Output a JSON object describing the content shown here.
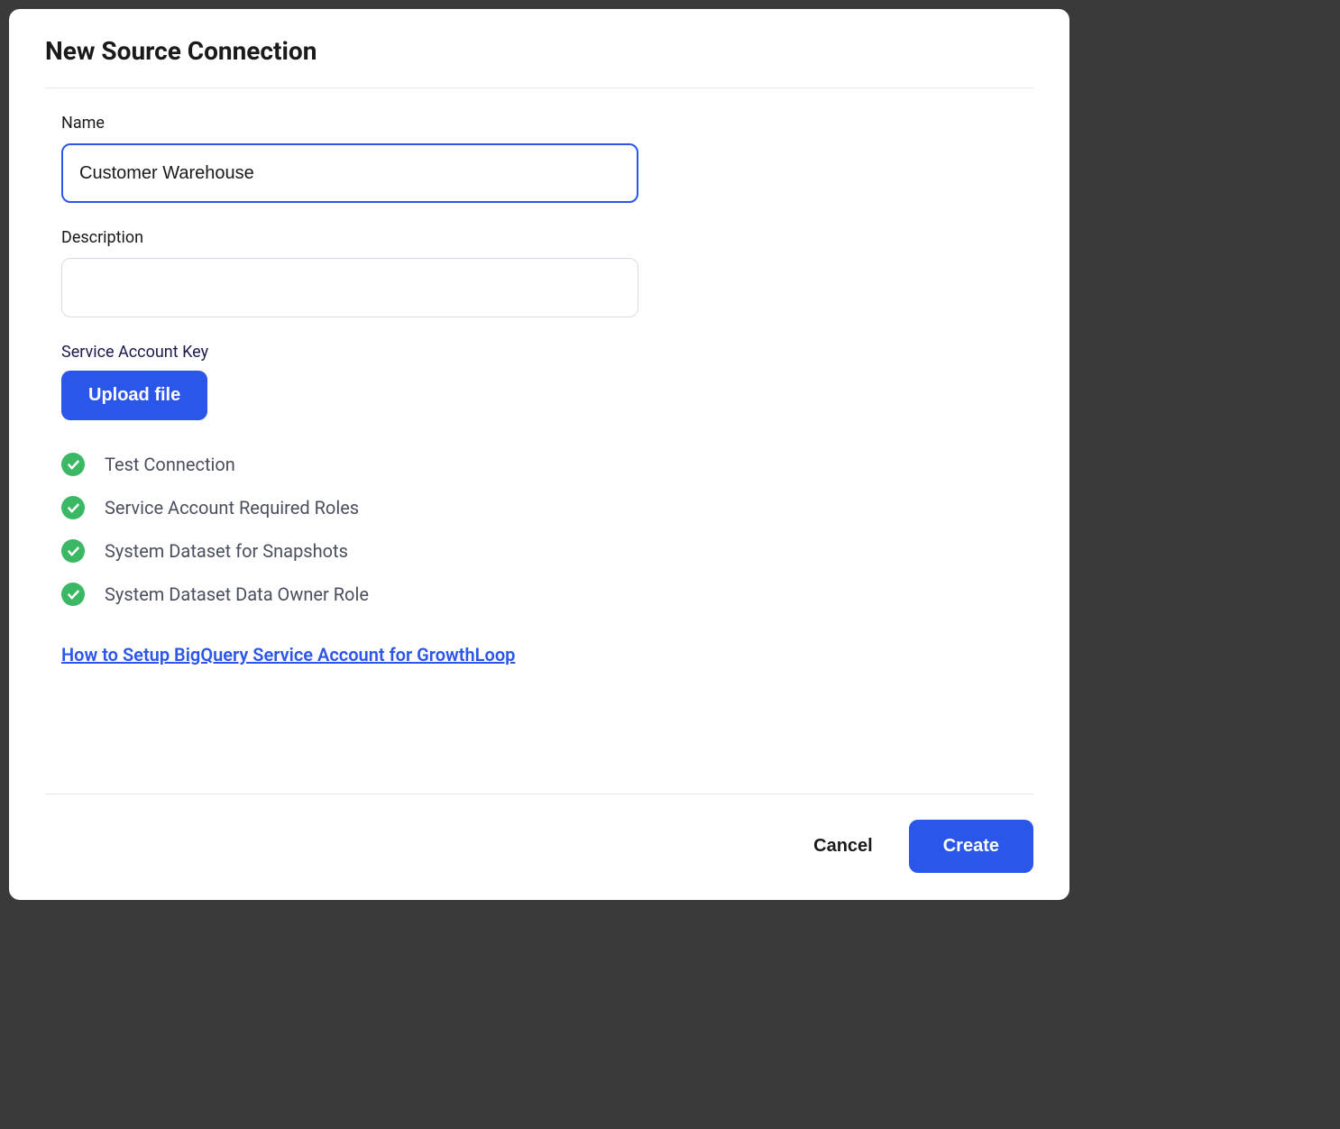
{
  "modal": {
    "title": "New Source Connection"
  },
  "form": {
    "name_label": "Name",
    "name_value": "Customer Warehouse",
    "description_label": "Description",
    "description_value": "",
    "service_account_key_label": "Service Account Key",
    "upload_button_label": "Upload file"
  },
  "checks": [
    {
      "label": "Test Connection"
    },
    {
      "label": "Service Account Required Roles"
    },
    {
      "label": "System Dataset for Snapshots"
    },
    {
      "label": "System Dataset Data Owner Role"
    }
  ],
  "help_link": {
    "label": "How to Setup BigQuery Service Account for GrowthLoop"
  },
  "footer": {
    "cancel_label": "Cancel",
    "create_label": "Create"
  },
  "colors": {
    "primary": "#2a56ea",
    "success": "#3bb864",
    "text": "#1a1a1a",
    "muted": "#4a4f5e"
  }
}
